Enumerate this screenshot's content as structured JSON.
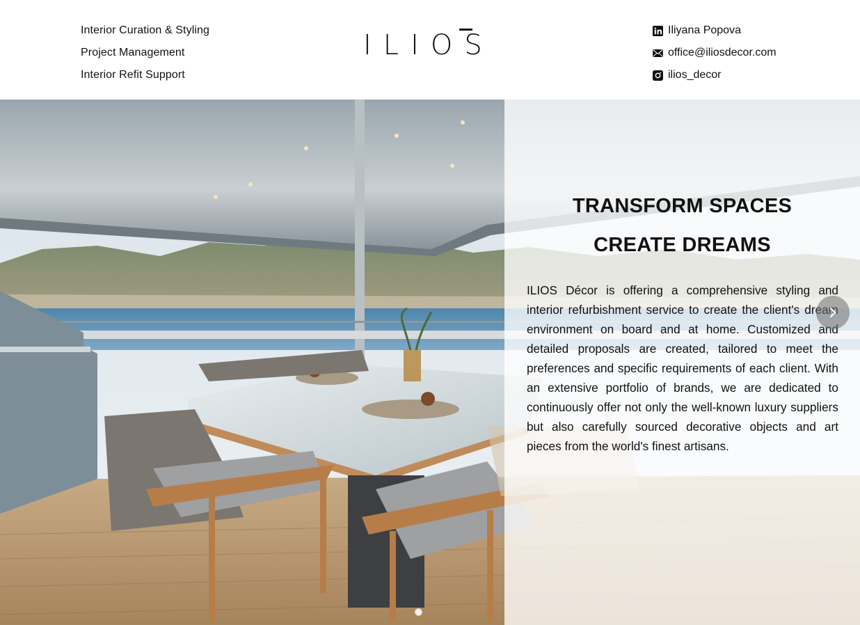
{
  "header": {
    "services": [
      "Interior Curation & Styling",
      "Project Management",
      "Interior Refit Support"
    ],
    "logo": "ILIOS",
    "contacts": {
      "linkedin": "Iliyana Popova",
      "email": "office@iliosdecor.com",
      "instagram": "ilios_decor"
    }
  },
  "hero": {
    "title_line1": "TRANSFORM SPACES",
    "title_line2": "CREATE DREAMS",
    "body": "ILIOS Décor is offering a comprehensive styling and interior refurbishment service to create the client's dream environment on board and at home. Customized and detailed proposals are created, tailored to meet the preferences and specific requirements of each client. With an extensive portfolio of brands, we are dedicated to continuously offer not only the well-known luxury suppliers but also carefully sourced decorative objects and art pieces from the world's finest artisans.",
    "slider": {
      "next_icon": "chevron-right-icon",
      "current_slide": 1
    }
  },
  "colors": {
    "text": "#111111",
    "overlay": "#ffffffc7",
    "teak": "#b89a74",
    "sea": "#5a8fb3"
  }
}
